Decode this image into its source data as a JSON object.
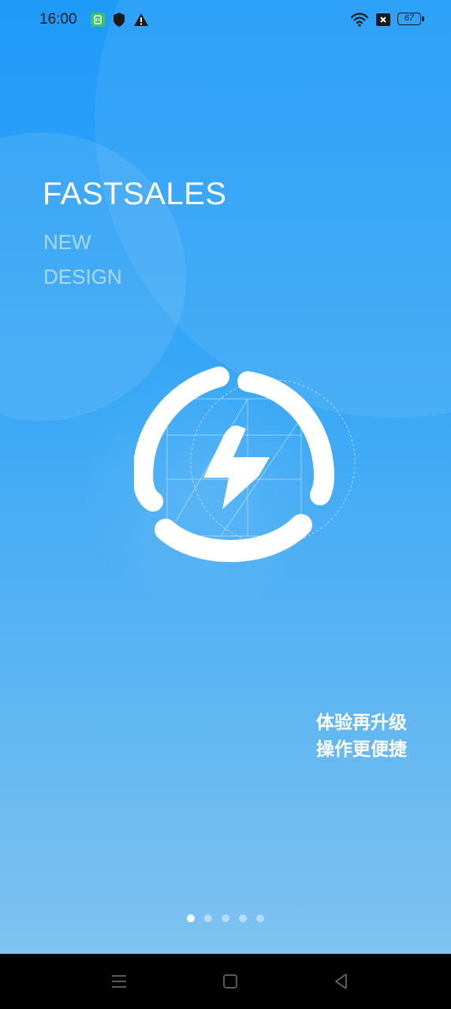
{
  "status_bar": {
    "time": "16:00",
    "battery_level": "67",
    "icons": [
      "app-notification-icon",
      "shield-icon",
      "warning-icon",
      "wifi-icon",
      "sim-no-signal-icon",
      "battery-icon"
    ]
  },
  "brand": {
    "title": "FASTSALES",
    "subtitle_line1": "NEW",
    "subtitle_line2": "DESIGN"
  },
  "logo": {
    "icon": "lightning-logo-icon"
  },
  "slogan": {
    "line1": "体验再升级",
    "line2": "操作更便捷"
  },
  "pager": {
    "total": 5,
    "active_index": 0
  },
  "nav_bar": {
    "buttons": [
      "menu-icon",
      "home-icon",
      "back-icon"
    ]
  },
  "colors": {
    "background_top": "#1e9af8",
    "background_bottom": "#86c6f0",
    "text": "#ffffff"
  }
}
